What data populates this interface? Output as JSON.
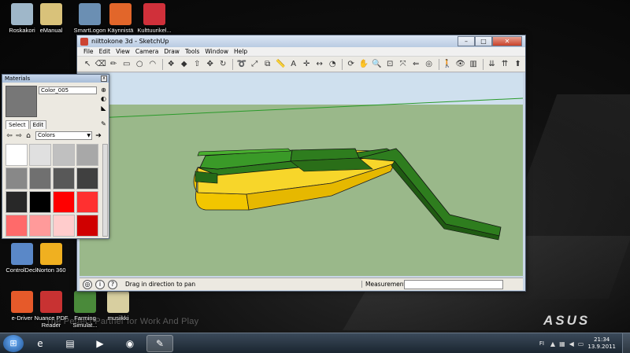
{
  "desktop": {
    "icons_top": [
      {
        "name": "recycle-bin-icon",
        "label": "Roskakori",
        "color": "#9fb7c9"
      },
      {
        "name": "emanual-icon",
        "label": "eManual",
        "color": "#d9c27a"
      },
      {
        "name": "smartlogon-icon",
        "label": "SmartLogon",
        "color": "#6b8fb3"
      },
      {
        "name": "kaynnista-icon",
        "label": "Käynnistä",
        "color": "#e2662a"
      },
      {
        "name": "kulttuurikeli-icon",
        "label": "Kulttuurikel...",
        "color": "#d0303a"
      }
    ],
    "icons_lower": [
      {
        "name": "controldeck-icon",
        "label": "ControlDeck",
        "color": "#5a88c8"
      },
      {
        "name": "norton-icon",
        "label": "Norton 360",
        "color": "#f0b020"
      },
      {
        "name": "edriver-icon",
        "label": "e-Driver",
        "color": "#e65a2a"
      },
      {
        "name": "nuance-pdf-icon",
        "label": "Nuance PDF Reader",
        "color": "#c83232"
      },
      {
        "name": "farming-sim-icon",
        "label": "Farming Simulat...",
        "color": "#4a8a3a"
      },
      {
        "name": "musiikki-icon",
        "label": "musiikki",
        "color": "#d8cfa0"
      }
    ],
    "slogan": "The Perfect Partner for Work And Play",
    "brand": "ASUS"
  },
  "window": {
    "title": "niittokone 3d - SketchUp",
    "buttons": {
      "minimize": "–",
      "maximize": "□",
      "close": "✕"
    },
    "menu": [
      "File",
      "Edit",
      "View",
      "Camera",
      "Draw",
      "Tools",
      "Window",
      "Help"
    ],
    "toolbar_icons": [
      "select-icon",
      "eraser-icon",
      "pencil-icon",
      "rectangle-icon",
      "circle-icon",
      "arc-icon",
      "make-component-icon",
      "paint-bucket-icon",
      "push-pull-icon",
      "move-icon",
      "rotate-icon",
      "follow-me-icon",
      "scale-icon",
      "offset-icon",
      "tape-measure-icon",
      "text-icon",
      "axes-icon",
      "dimension-icon",
      "protractor-icon",
      "orbit-icon",
      "pan-icon",
      "zoom-icon",
      "zoom-window-icon",
      "zoom-extents-icon",
      "previous-view-icon",
      "position-camera-icon",
      "walk-icon",
      "look-around-icon",
      "section-plane-icon",
      "get-models-icon",
      "share-model-icon",
      "share-component-icon"
    ],
    "status": {
      "text": "Drag in direction to pan",
      "measurements_label": "Measurements",
      "measurements_value": ""
    },
    "colors": {
      "ground": "#9ab88a",
      "sky": "#cfe0ee",
      "model_green": "#2e7d1e",
      "model_yellow": "#f2c600"
    }
  },
  "materials": {
    "title": "Materials",
    "name_value": "Color_005",
    "tabs": [
      "Select",
      "Edit"
    ],
    "collection": "Colors",
    "swatches": [
      "#ffffff",
      "#e0e0e0",
      "#c0c0c0",
      "#a8a8a8",
      "#888888",
      "#707070",
      "#585858",
      "#404040",
      "#282828",
      "#000000",
      "#ff0000",
      "#ff3030",
      "#ff6a6a",
      "#ff9a9a",
      "#ffcccc",
      "#d00000"
    ]
  },
  "taskbar": {
    "apps": [
      {
        "name": "ie-taskbar-icon",
        "glyph": "e",
        "active": false
      },
      {
        "name": "explorer-taskbar-icon",
        "glyph": "▤",
        "active": false
      },
      {
        "name": "media-player-taskbar-icon",
        "glyph": "▶",
        "active": false
      },
      {
        "name": "firefox-taskbar-icon",
        "glyph": "◉",
        "active": false
      },
      {
        "name": "sketchup-taskbar-icon",
        "glyph": "✎",
        "active": true
      }
    ],
    "language": "FI",
    "time": "21:34",
    "date": "13.9.2011"
  }
}
